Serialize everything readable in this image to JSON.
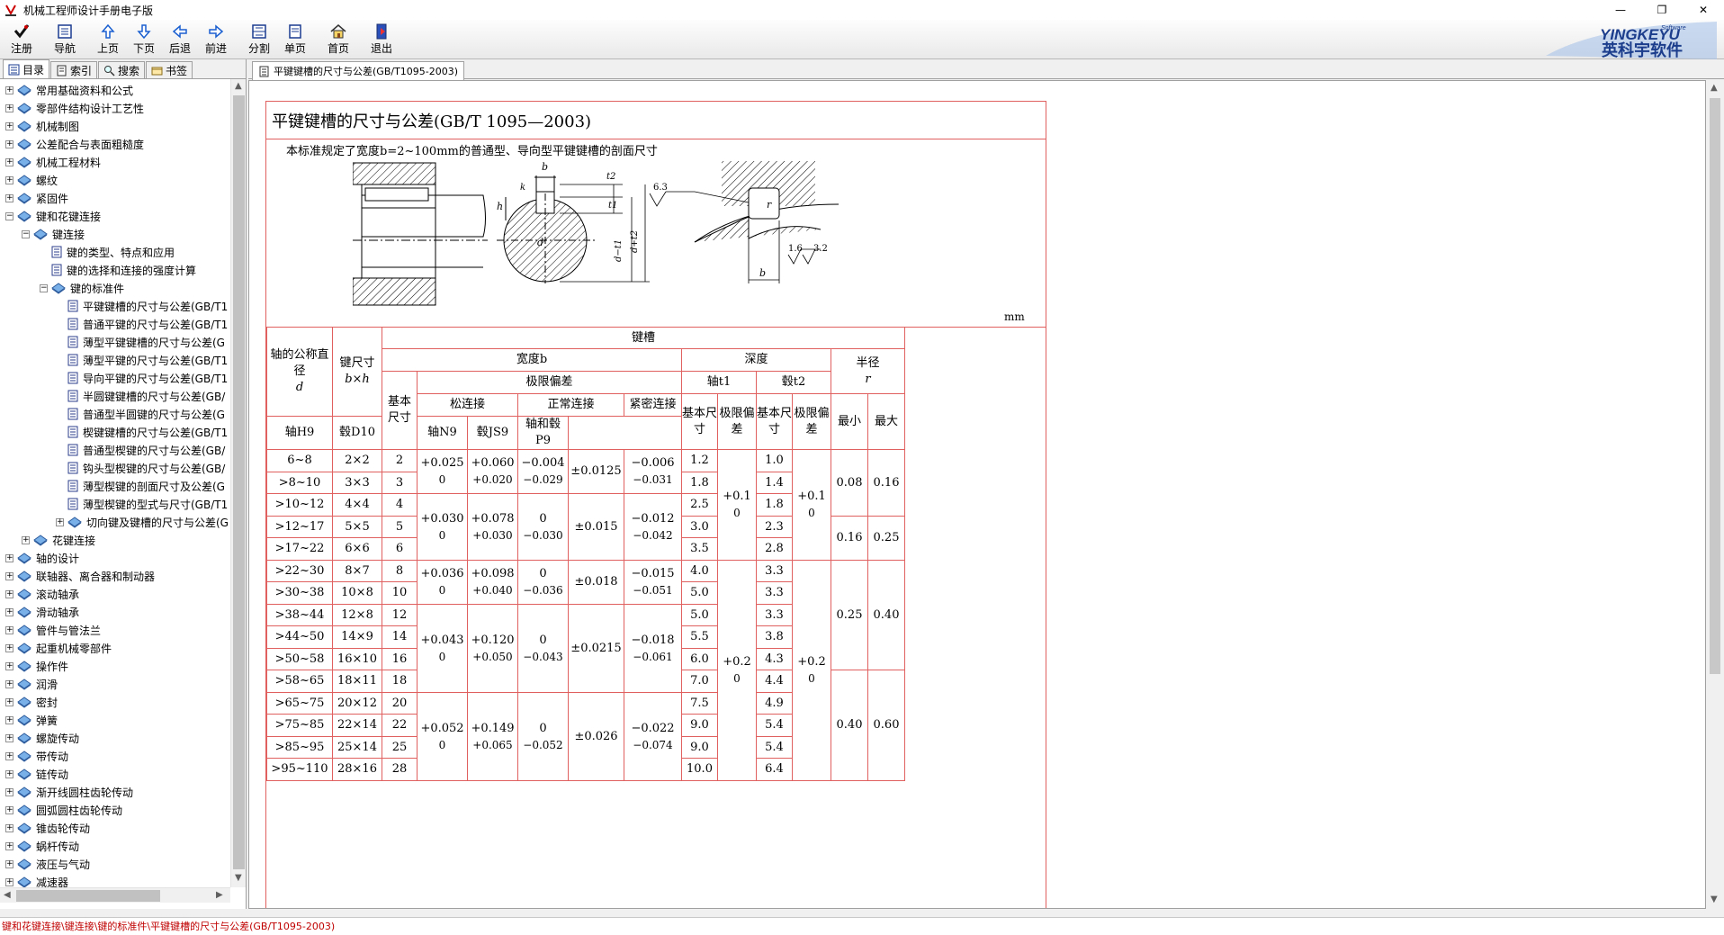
{
  "window": {
    "title": "机械工程师设计手册电子版",
    "minimize": "—",
    "maximize": "❐",
    "close": "✕"
  },
  "toolbar": {
    "buttons": [
      {
        "label": "注册",
        "icon": "check-icon"
      },
      {
        "label": "导航",
        "icon": "navigation-icon"
      },
      {
        "label": "上页",
        "icon": "arrow-up-icon"
      },
      {
        "label": "下页",
        "icon": "arrow-down-icon"
      },
      {
        "label": "后退",
        "icon": "arrow-left-icon"
      },
      {
        "label": "前进",
        "icon": "arrow-right-icon"
      },
      {
        "label": "分割",
        "icon": "split-icon"
      },
      {
        "label": "单页",
        "icon": "single-page-icon"
      },
      {
        "label": "首页",
        "icon": "home-icon"
      },
      {
        "label": "退出",
        "icon": "exit-icon"
      }
    ],
    "brand_name": "英科宇软件",
    "brand_latin": "YINGKEYU",
    "brand_sub": "Software"
  },
  "left_tabs": [
    "目录",
    "索引",
    "搜索",
    "书签"
  ],
  "tree": [
    {
      "label": "常用基础资料和公式",
      "level": 0,
      "type": "book",
      "exp": "+"
    },
    {
      "label": "零部件结构设计工艺性",
      "level": 0,
      "type": "book",
      "exp": "+"
    },
    {
      "label": "机械制图",
      "level": 0,
      "type": "book",
      "exp": "+"
    },
    {
      "label": "公差配合与表面粗糙度",
      "level": 0,
      "type": "book",
      "exp": "+"
    },
    {
      "label": "机械工程材料",
      "level": 0,
      "type": "book",
      "exp": "+"
    },
    {
      "label": "螺纹",
      "level": 0,
      "type": "book",
      "exp": "+"
    },
    {
      "label": "紧固件",
      "level": 0,
      "type": "book",
      "exp": "+"
    },
    {
      "label": "键和花键连接",
      "level": 0,
      "type": "book",
      "exp": "−"
    },
    {
      "label": "键连接",
      "level": 1,
      "type": "book",
      "exp": "−"
    },
    {
      "label": "键的类型、特点和应用",
      "level": 2,
      "type": "page",
      "exp": ""
    },
    {
      "label": "键的选择和连接的强度计算",
      "level": 2,
      "type": "page",
      "exp": ""
    },
    {
      "label": "键的标准件",
      "level": 2,
      "type": "book",
      "exp": "−"
    },
    {
      "label": "平键键槽的尺寸与公差(GB/T1",
      "level": 3,
      "type": "page",
      "exp": "",
      "selected": true
    },
    {
      "label": "普通平键的尺寸与公差(GB/T1",
      "level": 3,
      "type": "page",
      "exp": ""
    },
    {
      "label": "薄型平键键槽的尺寸与公差(G",
      "level": 3,
      "type": "page",
      "exp": ""
    },
    {
      "label": "薄型平键的尺寸与公差(GB/T1",
      "level": 3,
      "type": "page",
      "exp": ""
    },
    {
      "label": "导向平键的尺寸与公差(GB/T1",
      "level": 3,
      "type": "page",
      "exp": ""
    },
    {
      "label": "半圆键键槽的尺寸与公差(GB/",
      "level": 3,
      "type": "page",
      "exp": ""
    },
    {
      "label": "普通型半圆键的尺寸与公差(G",
      "level": 3,
      "type": "page",
      "exp": ""
    },
    {
      "label": "楔键键槽的尺寸与公差(GB/T1",
      "level": 3,
      "type": "page",
      "exp": ""
    },
    {
      "label": "普通型楔键的尺寸与公差(GB/",
      "level": 3,
      "type": "page",
      "exp": ""
    },
    {
      "label": "钩头型楔键的尺寸与公差(GB/",
      "level": 3,
      "type": "page",
      "exp": ""
    },
    {
      "label": "薄型楔键的剖面尺寸及公差(G",
      "level": 3,
      "type": "page",
      "exp": ""
    },
    {
      "label": "薄型楔键的型式与尺寸(GB/T1",
      "level": 3,
      "type": "page",
      "exp": ""
    },
    {
      "label": "切向键及键槽的尺寸与公差(G",
      "level": 3,
      "type": "book",
      "exp": "+"
    },
    {
      "label": "花键连接",
      "level": 1,
      "type": "book",
      "exp": "+"
    },
    {
      "label": "轴的设计",
      "level": 0,
      "type": "book",
      "exp": "+"
    },
    {
      "label": "联轴器、离合器和制动器",
      "level": 0,
      "type": "book",
      "exp": "+"
    },
    {
      "label": "滚动轴承",
      "level": 0,
      "type": "book",
      "exp": "+"
    },
    {
      "label": "滑动轴承",
      "level": 0,
      "type": "book",
      "exp": "+"
    },
    {
      "label": "管件与管法兰",
      "level": 0,
      "type": "book",
      "exp": "+"
    },
    {
      "label": "起重机械零部件",
      "level": 0,
      "type": "book",
      "exp": "+"
    },
    {
      "label": "操作件",
      "level": 0,
      "type": "book",
      "exp": "+"
    },
    {
      "label": "润滑",
      "level": 0,
      "type": "book",
      "exp": "+"
    },
    {
      "label": "密封",
      "level": 0,
      "type": "book",
      "exp": "+"
    },
    {
      "label": "弹簧",
      "level": 0,
      "type": "book",
      "exp": "+"
    },
    {
      "label": "螺旋传动",
      "level": 0,
      "type": "book",
      "exp": "+"
    },
    {
      "label": "带传动",
      "level": 0,
      "type": "book",
      "exp": "+"
    },
    {
      "label": "链传动",
      "level": 0,
      "type": "book",
      "exp": "+"
    },
    {
      "label": "渐开线圆柱齿轮传动",
      "level": 0,
      "type": "book",
      "exp": "+"
    },
    {
      "label": "圆弧圆柱齿轮传动",
      "level": 0,
      "type": "book",
      "exp": "+"
    },
    {
      "label": "锥齿轮传动",
      "level": 0,
      "type": "book",
      "exp": "+"
    },
    {
      "label": "蜗杆传动",
      "level": 0,
      "type": "book",
      "exp": "+"
    },
    {
      "label": "液压与气动",
      "level": 0,
      "type": "book",
      "exp": "+"
    },
    {
      "label": "减速器",
      "level": 0,
      "type": "book",
      "exp": "+"
    }
  ],
  "doc_tab": "平键键槽的尺寸与公差(GB/T1095-2003)",
  "doc": {
    "title": "平键键槽的尺寸与公差(GB/T 1095—2003)",
    "intro": "本标准规定了宽度b=2~100mm的普通型、导向型平键键槽的剖面尺寸",
    "unit": "mm",
    "drawing_labels": {
      "b": "b",
      "k": "k",
      "h": "h",
      "t1": "t1",
      "t2": "t2",
      "d_minus_t1": "d−t1",
      "d_plus_t2": "d+t2",
      "r": "r",
      "ra1": "6.3",
      "ra2": "1.6",
      "ra3": "3.2",
      "d": "d"
    }
  },
  "table": {
    "h_keyslot": "键槽",
    "h_shaft_dia": "轴的公称直径",
    "h_shaft_dia_sym": "d",
    "h_key_size": "键尺寸",
    "h_key_size_sym": "b×h",
    "h_width": "宽度b",
    "h_depth": "深度",
    "h_radius": "半径",
    "h_radius_sym": "r",
    "h_basic": "基本尺寸",
    "h_limit_dev": "极限偏差",
    "h_loose": "松连接",
    "h_normal": "正常连接",
    "h_tight": "紧密连接",
    "h_shaft_t1": "轴t1",
    "h_hub_t2": "毂t2",
    "h_shaft_basic": "基本尺寸",
    "h_shaft_limit": "极限偏差",
    "h_hub_basic": "基本尺寸",
    "h_hub_limit": "极限偏差",
    "h_h9": "轴H9",
    "h_d10": "毂D10",
    "h_n9": "轴N9",
    "h_js9": "毂JS9",
    "h_p9": "轴和毂P9",
    "h_min": "最小",
    "h_max": "最大",
    "rows": [
      {
        "d": "6~8",
        "bxh": "2×2",
        "b": "2",
        "t1": "1.2",
        "t2": "1.0"
      },
      {
        "d": ">8~10",
        "bxh": "3×3",
        "b": "3",
        "t1": "1.8",
        "t2": "1.4"
      },
      {
        "d": ">10~12",
        "bxh": "4×4",
        "b": "4",
        "t1": "2.5",
        "t2": "1.8"
      },
      {
        "d": ">12~17",
        "bxh": "5×5",
        "b": "5",
        "t1": "3.0",
        "t2": "2.3"
      },
      {
        "d": ">17~22",
        "bxh": "6×6",
        "b": "6",
        "t1": "3.5",
        "t2": "2.8"
      },
      {
        "d": ">22~30",
        "bxh": "8×7",
        "b": "8",
        "t1": "4.0",
        "t2": "3.3"
      },
      {
        "d": ">30~38",
        "bxh": "10×8",
        "b": "10",
        "t1": "5.0",
        "t2": "3.3"
      },
      {
        "d": ">38~44",
        "bxh": "12×8",
        "b": "12",
        "t1": "5.0",
        "t2": "3.3"
      },
      {
        "d": ">44~50",
        "bxh": "14×9",
        "b": "14",
        "t1": "5.5",
        "t2": "3.8"
      },
      {
        "d": ">50~58",
        "bxh": "16×10",
        "b": "16",
        "t1": "6.0",
        "t2": "4.3"
      },
      {
        "d": ">58~65",
        "bxh": "18×11",
        "b": "18",
        "t1": "7.0",
        "t2": "4.4"
      },
      {
        "d": ">65~75",
        "bxh": "20×12",
        "b": "20",
        "t1": "7.5",
        "t2": "4.9"
      },
      {
        "d": ">75~85",
        "bxh": "22×14",
        "b": "22",
        "t1": "9.0",
        "t2": "5.4"
      },
      {
        "d": ">85~95",
        "bxh": "25×14",
        "b": "25",
        "t1": "9.0",
        "t2": "5.4"
      },
      {
        "d": ">95~110",
        "bxh": "28×16",
        "b": "28",
        "t1": "10.0",
        "t2": "6.4"
      }
    ],
    "groups": [
      {
        "h9a": "+0.025",
        "h9b": "0",
        "d10a": "+0.060",
        "d10b": "+0.020",
        "n9a": "−0.004",
        "n9b": "−0.029",
        "js9": "±0.0125",
        "p9a": "−0.006",
        "p9b": "−0.031"
      },
      {
        "h9a": "+0.030",
        "h9b": "0",
        "d10a": "+0.078",
        "d10b": "+0.030",
        "n9a": "0",
        "n9b": "−0.030",
        "js9": "±0.015",
        "p9a": "−0.012",
        "p9b": "−0.042"
      },
      {
        "h9a": "+0.036",
        "h9b": "0",
        "d10a": "+0.098",
        "d10b": "+0.040",
        "n9a": "0",
        "n9b": "−0.036",
        "js9": "±0.018",
        "p9a": "−0.015",
        "p9b": "−0.051"
      },
      {
        "h9a": "+0.043",
        "h9b": "0",
        "d10a": "+0.120",
        "d10b": "+0.050",
        "n9a": "0",
        "n9b": "−0.043",
        "js9": "±0.0215",
        "p9a": "−0.018",
        "p9b": "−0.061"
      },
      {
        "h9a": "+0.052",
        "h9b": "0",
        "d10a": "+0.149",
        "d10b": "+0.065",
        "n9a": "0",
        "n9b": "−0.052",
        "js9": "±0.026",
        "p9a": "−0.022",
        "p9b": "−0.074"
      }
    ],
    "t1_dev_1a": "+0.1",
    "t1_dev_1b": "0",
    "t1_dev_2a": "+0.2",
    "t1_dev_2b": "0",
    "t2_dev_1a": "+0.1",
    "t2_dev_1b": "0",
    "t2_dev_2a": "+0.2",
    "t2_dev_2b": "0",
    "r_groups": [
      {
        "min": "0.08",
        "max": "0.16"
      },
      {
        "min": "0.16",
        "max": "0.25"
      },
      {
        "min": "0.25",
        "max": "0.40"
      },
      {
        "min": "0.40",
        "max": "0.60"
      }
    ]
  },
  "status": "键和花键连接\\键连接\\键的标准件\\平键键槽的尺寸与公差(GB/T1095-2003)"
}
